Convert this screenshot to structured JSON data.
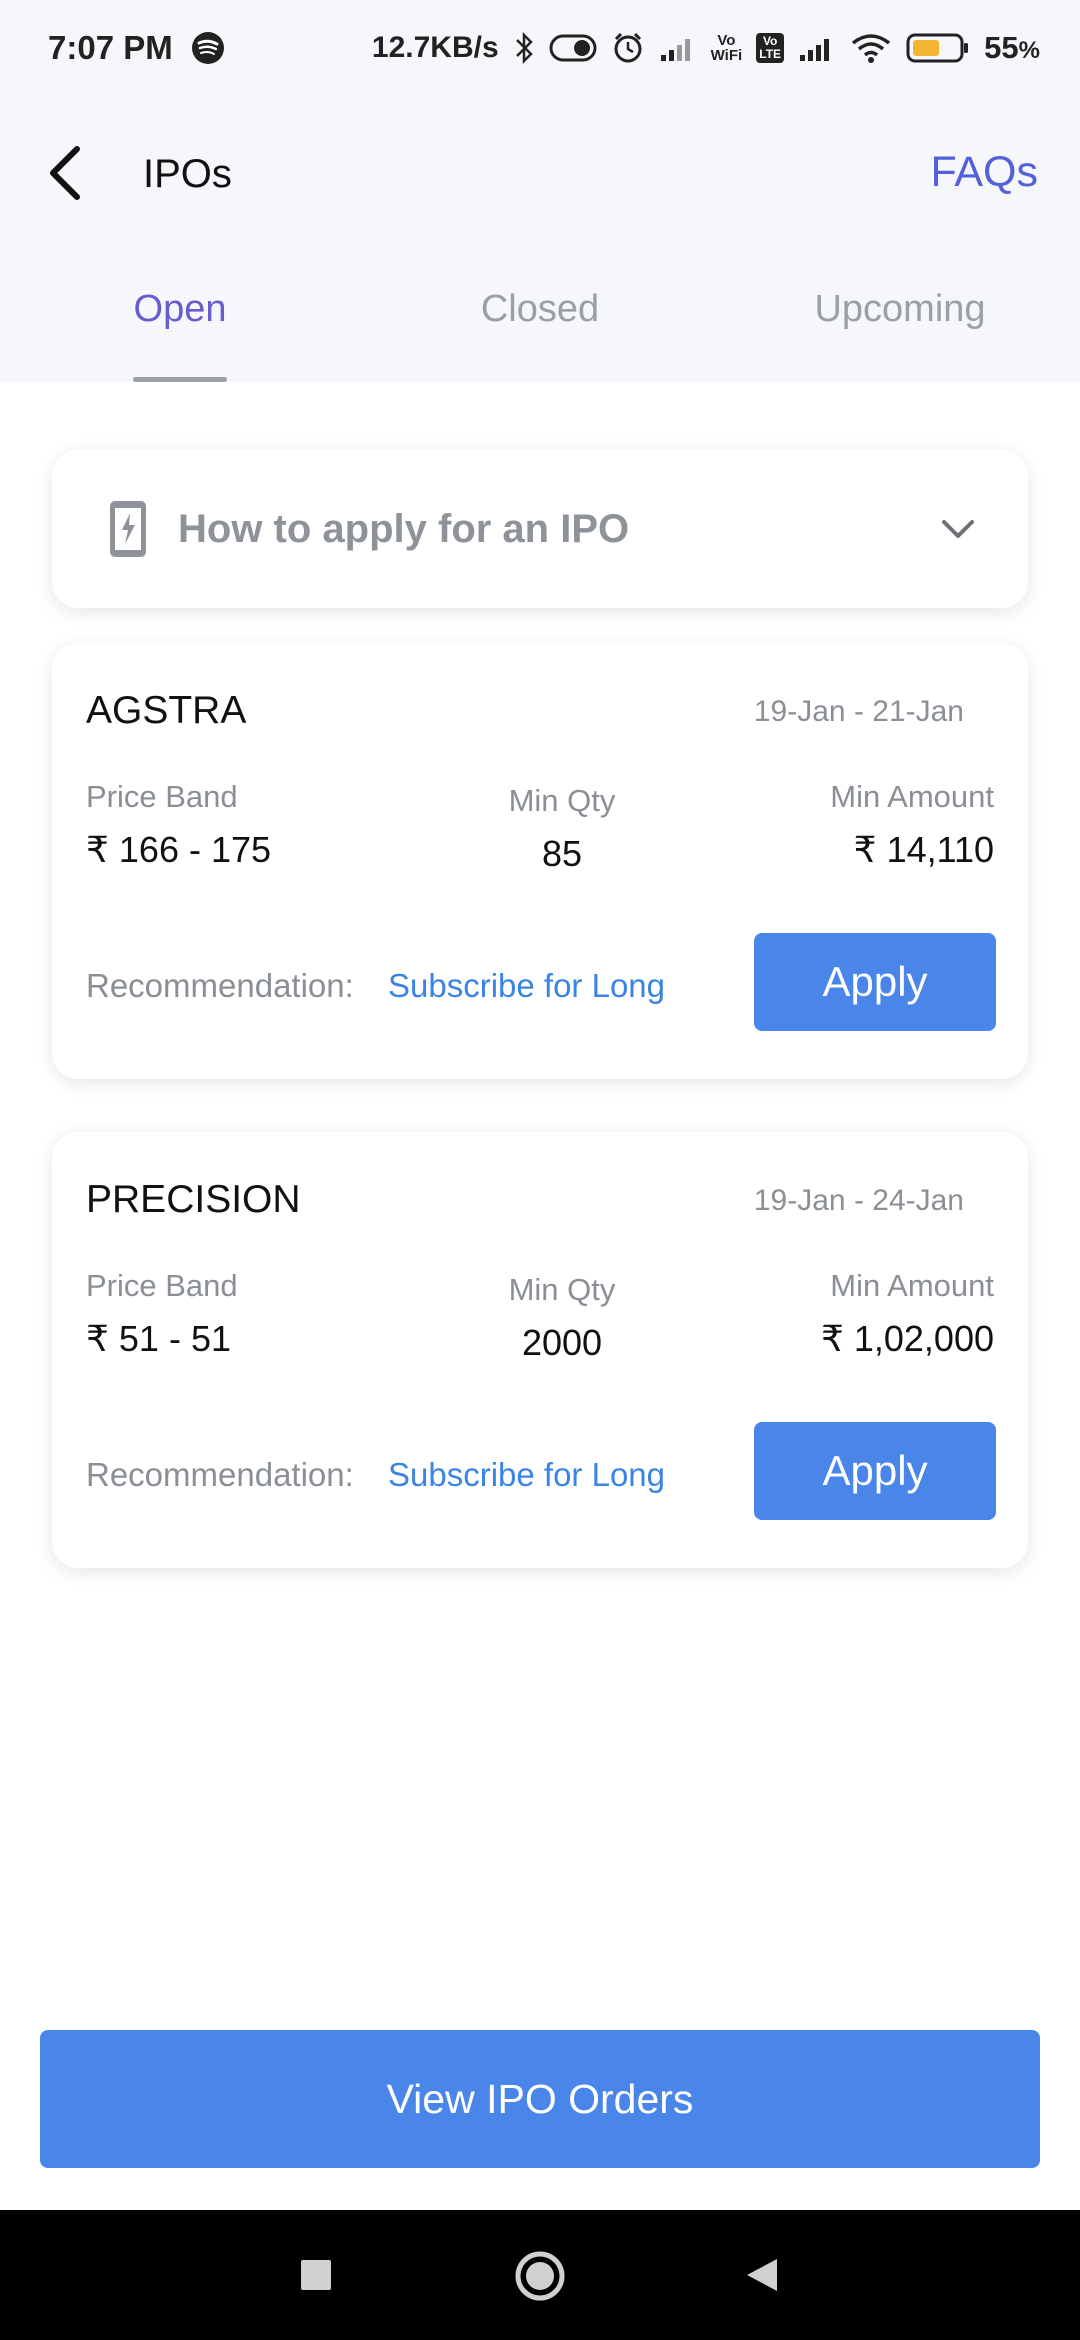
{
  "status_bar": {
    "time": "7:07 PM",
    "net_speed": "12.7KB/s",
    "battery_percent": "55",
    "battery_unit": "%",
    "vowifi_label_1": "Vo",
    "vowifi_label_2": "WiFi",
    "volte_label": "Vo LTE",
    "icons": [
      "spotify-icon",
      "bluetooth-icon",
      "toggle-icon",
      "alarm-icon",
      "signal-icon",
      "vowifi-icon",
      "volte-icon",
      "signal-icon",
      "wifi-icon",
      "battery-icon"
    ]
  },
  "header": {
    "title": "IPOs",
    "faqs_label": "FAQs"
  },
  "tabs": [
    {
      "label": "Open",
      "active": true
    },
    {
      "label": "Closed",
      "active": false
    },
    {
      "label": "Upcoming",
      "active": false
    }
  ],
  "howto": {
    "title": "How to apply for an IPO"
  },
  "ipos": [
    {
      "name": "AGSTRA",
      "dates": "19-Jan - 21-Jan",
      "price_band_label": "Price Band",
      "price_band": "₹ 166 - 175",
      "min_qty_label": "Min Qty",
      "min_qty": "85",
      "min_amount_label": "Min Amount",
      "min_amount": "₹ 14,110",
      "recommendation_label": "Recommendation:",
      "recommendation": "Subscribe for Long",
      "apply_label": "Apply"
    },
    {
      "name": "PRECISION",
      "dates": "19-Jan - 24-Jan",
      "price_band_label": "Price Band",
      "price_band": "₹ 51 - 51",
      "min_qty_label": "Min Qty",
      "min_qty": "2000",
      "min_amount_label": "Min Amount",
      "min_amount": "₹ 1,02,000",
      "recommendation_label": "Recommendation:",
      "recommendation": "Subscribe for Long",
      "apply_label": "Apply"
    }
  ],
  "footer": {
    "view_orders_label": "View IPO Orders"
  },
  "colors": {
    "accent_blue": "#4a86ea",
    "tab_active": "#6a5bd0",
    "link_blue": "#3a84e6",
    "faq_blue": "#5361d9"
  }
}
